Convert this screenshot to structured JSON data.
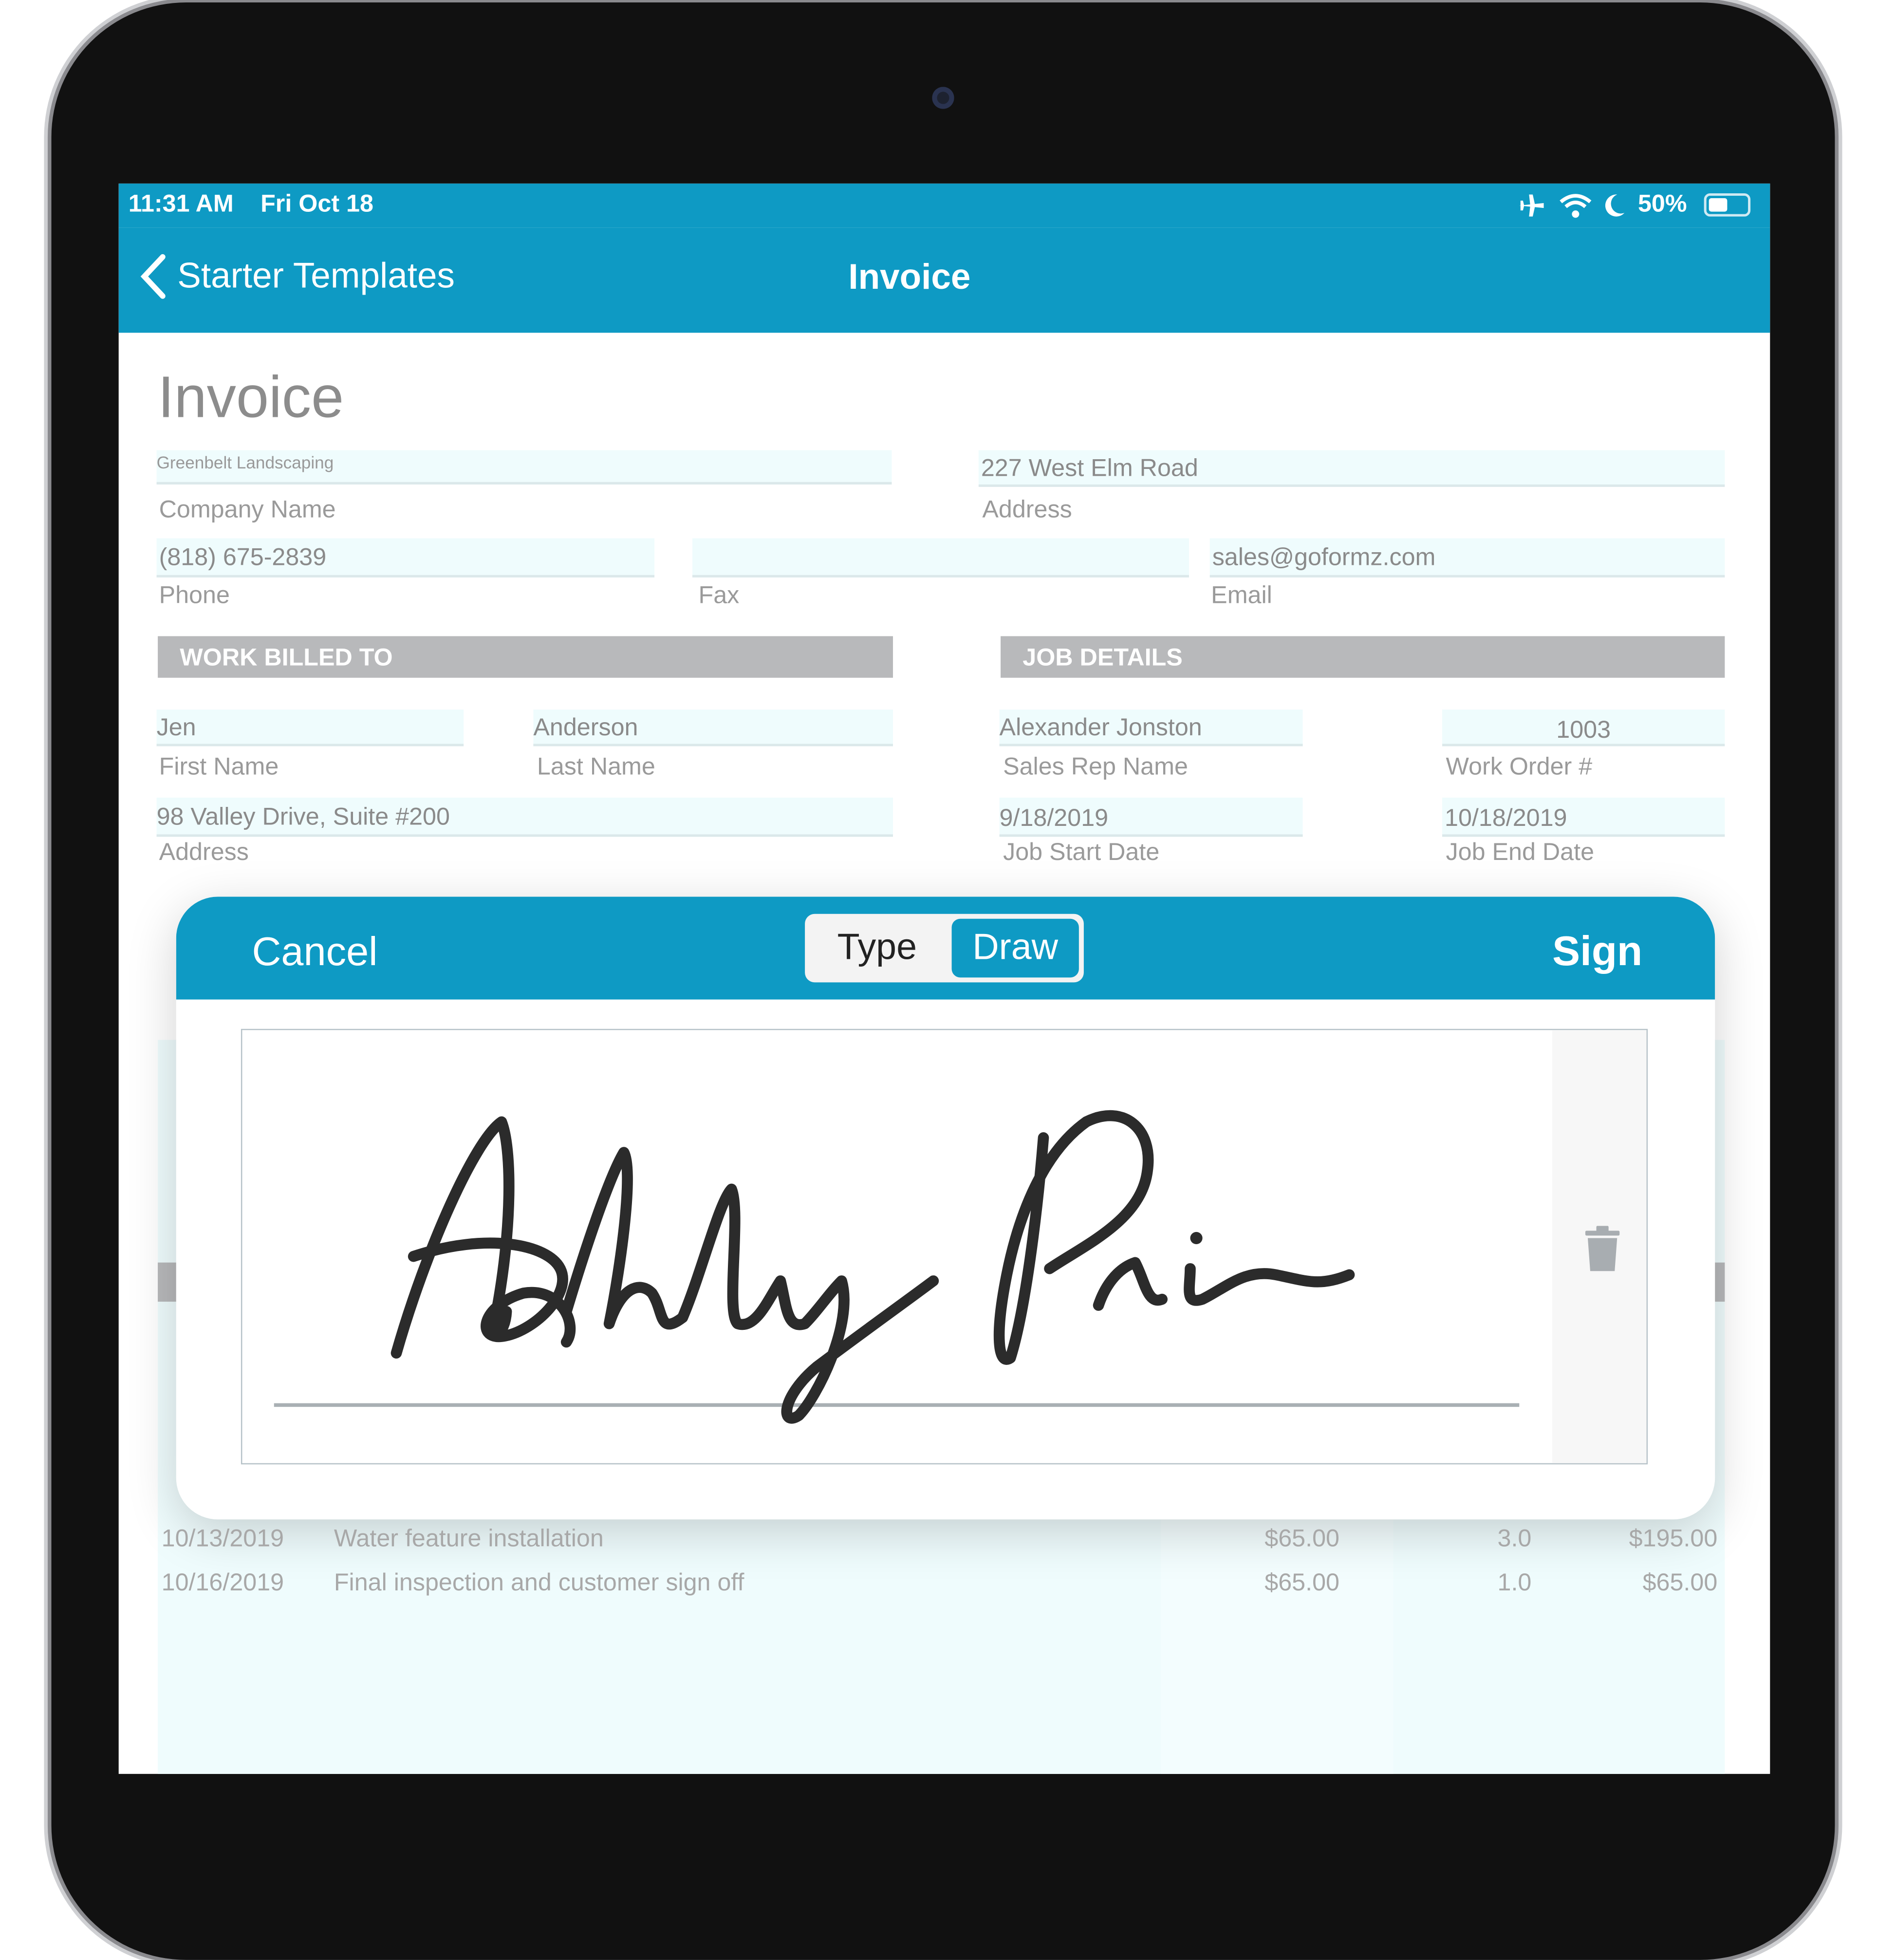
{
  "status_bar": {
    "time": "11:31 AM",
    "date": "Fri Oct 18",
    "battery": "50%",
    "battery_level": 0.5,
    "icons": [
      "airplane-icon",
      "wifi-icon",
      "moon-icon",
      "battery-icon"
    ]
  },
  "nav": {
    "back_label": "Starter Templates",
    "title": "Invoice"
  },
  "colors": {
    "accent": "#0e9ac4",
    "field_bg": "#effcfd",
    "section_bg": "#b8b9bb"
  },
  "form": {
    "title": "Invoice",
    "company_name": {
      "value": "Greenbelt Landscaping",
      "label": "Company Name"
    },
    "address": {
      "value": "227 West Elm Road",
      "label": "Address"
    },
    "phone": {
      "value": "(818) 675-2839",
      "label": "Phone"
    },
    "fax": {
      "value": "",
      "label": "Fax"
    },
    "email": {
      "value": "sales@goformz.com",
      "label": "Email"
    },
    "work_billed_to": {
      "header": "WORK BILLED TO",
      "first_name": {
        "value": "Jen",
        "label": "First Name"
      },
      "last_name": {
        "value": "Anderson",
        "label": "Last Name"
      },
      "address": {
        "value": "98 Valley Drive, Suite #200",
        "label": "Address"
      }
    },
    "job_details": {
      "header": "JOB DETAILS",
      "sales_rep": {
        "value": "Alexander Jonston",
        "label": "Sales Rep Name"
      },
      "work_order": {
        "value": "1003",
        "label": "Work Order #"
      },
      "start_date": {
        "value": "9/18/2019",
        "label": "Job Start Date"
      },
      "end_date": {
        "value": "10/18/2019",
        "label": "Job End Date"
      }
    },
    "line_items": [
      {
        "date": "10/13/2019",
        "description": "Water feature installation",
        "rate": "$65.00",
        "qty": "3.0",
        "total": "$195.00"
      },
      {
        "date": "10/16/2019",
        "description": "Final inspection and customer sign off",
        "rate": "$65.00",
        "qty": "1.0",
        "total": "$65.00"
      }
    ]
  },
  "signature_modal": {
    "cancel_label": "Cancel",
    "tabs": [
      {
        "label": "Type",
        "selected": false
      },
      {
        "label": "Draw",
        "selected": true
      }
    ],
    "sign_label": "Sign",
    "signature_text": "Ashly Prin",
    "clear_icon": "trash-icon"
  }
}
